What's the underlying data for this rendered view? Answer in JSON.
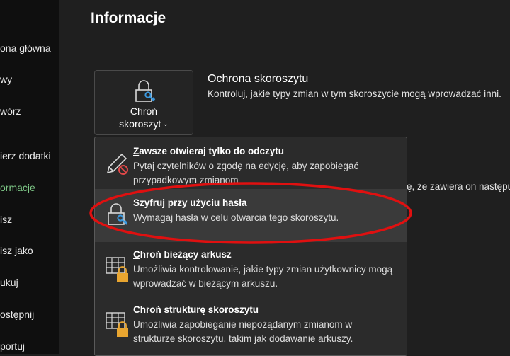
{
  "sidebar": {
    "items": [
      {
        "label": "ona główna"
      },
      {
        "label": "wy"
      },
      {
        "label": "wórz"
      },
      {
        "label": "ierz dodatki"
      },
      {
        "label": "ormacje"
      },
      {
        "label": "isz"
      },
      {
        "label": "isz jako"
      },
      {
        "label": "ukuj"
      },
      {
        "label": "ostępnij"
      },
      {
        "label": "portuj"
      }
    ],
    "active_color": "#7ec887"
  },
  "page": {
    "title": "Informacje"
  },
  "protect_button": {
    "line1": "Chroń",
    "line2": "skoroszyt",
    "chevron": "⌄",
    "icon": "lock-key-icon"
  },
  "section": {
    "title": "Ochrona skoroszytu",
    "desc": "Kontroluj, jakie typy zmian w tym skoroszycie mogą wprowadzać inni."
  },
  "background_fragment": "ę, że zawiera on następują",
  "menu": {
    "items": [
      {
        "title": "Zawsze otwieraj tylko do odczytu",
        "mnemonic": "Z",
        "rest": "awsze otwieraj tylko do odczytu",
        "desc": "Pytaj czytelników o zgodę na edycję, aby zapobiegać przypadkowym zmianom.",
        "icon": "pencil-no-icon"
      },
      {
        "title": "Szyfruj przy użyciu hasła",
        "mnemonic": "S",
        "rest": "zyfruj przy użyciu hasła",
        "desc": "Wymagaj hasła w celu otwarcia tego skoroszytu.",
        "icon": "lock-key-icon"
      },
      {
        "title": "Chroń bieżący arkusz",
        "mnemonic": "C",
        "rest": "hroń bieżący arkusz",
        "desc": "Umożliwia kontrolowanie, jakie typy zmian użytkownicy mogą wprowadzać w bieżącym arkuszu.",
        "icon": "sheet-lock-icon"
      },
      {
        "title": "Chroń strukturę skoroszytu",
        "mnemonic": "C",
        "rest": "hroń strukturę skoroszytu",
        "desc": "Umożliwia zapobieganie niepożądanym zmianom w strukturze skoroszytu, takim jak dodawanie arkuszy.",
        "icon": "workbook-lock-icon"
      }
    ]
  },
  "annotation": {
    "color": "#e01010"
  }
}
